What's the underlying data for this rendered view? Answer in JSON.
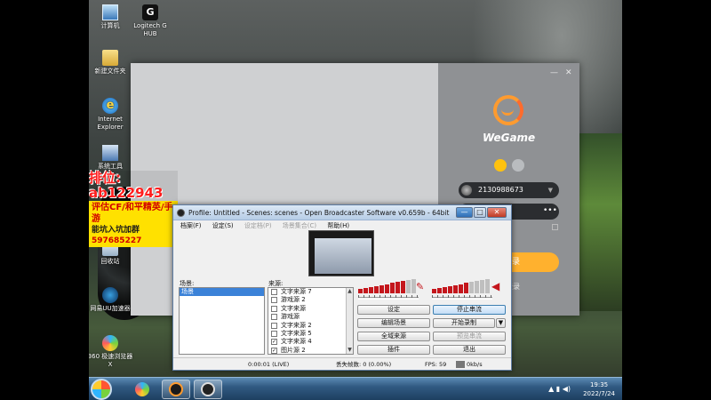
{
  "desktop_icons": [
    {
      "label": "计算机",
      "icon": "computer-icon"
    },
    {
      "label": "Logitech G HUB",
      "icon": "logitech-icon"
    },
    {
      "label": "新建文件夹",
      "icon": "folder-icon"
    },
    {
      "label": "Internet Explorer",
      "icon": "ie-icon"
    },
    {
      "label": "系统工具",
      "icon": "system-icon"
    },
    {
      "label": "回收站",
      "icon": "recycle-bin-icon"
    },
    {
      "label": "网易UU加速器",
      "icon": "network-icon"
    },
    {
      "label": "360 极速浏览器X",
      "icon": "browser-icon"
    }
  ],
  "overlay_ad": {
    "line1": "排位: ab122943",
    "line2": "评估CF/和平精英/手游",
    "line3_prefix": "能坑入坑加群",
    "line3_number": "597685227"
  },
  "taskbar": {
    "time": "19:35",
    "date": "2022/7/24",
    "apps": [
      "browser",
      "wegame",
      "obs"
    ]
  },
  "wegame": {
    "brand": "WeGame",
    "account": "2130988673",
    "password_mask": "•••",
    "login_label": "录",
    "register_label": "登录",
    "controls": {
      "minimize": "—",
      "close": "✕"
    }
  },
  "obs": {
    "title": "Profile: Untitled - Scenes: scenes - Open Broadcaster Software v0.659b - 64bit",
    "menu": [
      "档案(F)",
      "设定(S)",
      "设定档(P)",
      "场景集合(C)",
      "帮助(H)"
    ],
    "scenes_label": "场景:",
    "sources_label": "来源:",
    "scenes": [
      "场景"
    ],
    "sources": [
      {
        "name": "文字来源 7",
        "checked": false
      },
      {
        "name": "游戏源 2",
        "checked": false
      },
      {
        "name": "文字来源",
        "checked": false
      },
      {
        "name": "游戏源",
        "checked": false
      },
      {
        "name": "文字来源 2",
        "checked": false
      },
      {
        "name": "文字来源 5",
        "checked": false
      },
      {
        "name": "文字来源 4",
        "checked": true
      },
      {
        "name": "图片源 2",
        "checked": true
      }
    ],
    "buttons": {
      "settings": "设定",
      "stop_stream": "停止串流",
      "edit_scene": "编辑场景",
      "start_record": "开始录制",
      "global_sources": "全域来源",
      "preview_stream": "预览串流",
      "plugins": "插件",
      "exit": "退出"
    },
    "status": {
      "time": "0:00:01 (LIVE)",
      "dropped": "丢失帧数: 0 (0.00%)",
      "fps": "FPS: 59",
      "bitrate": "0kb/s"
    },
    "desktop_meter_level": 0.75,
    "mic_meter_level": 0.62,
    "colors": {
      "meter": "#c4161c",
      "selection": "#3b82d8"
    }
  }
}
